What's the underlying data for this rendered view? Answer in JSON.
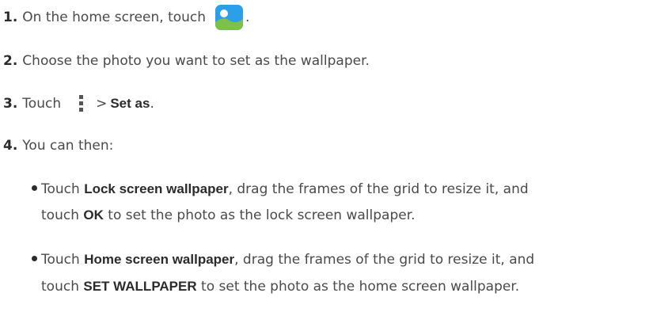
{
  "steps": [
    {
      "number": "1.",
      "text": "On the home screen, touch",
      "icon": "gallery-icon",
      "after": "."
    },
    {
      "number": "2.",
      "text": "Choose the photo you want to set as the wallpaper."
    },
    {
      "number": "3.",
      "text": "Touch",
      "icon": "more-vertical-icon",
      "gt": ">",
      "bold": "Set as",
      "after": "."
    },
    {
      "number": "4.",
      "text": "You can then:"
    }
  ],
  "bullets": [
    {
      "prefix": "Touch ",
      "bold1": "Lock screen wallpaper",
      "mid": ", drag the frames of the grid to resize it, and",
      "cont_prefix": "touch ",
      "bold2": "OK",
      "cont_suffix": " to set the photo as the lock screen wallpaper."
    },
    {
      "prefix": "Touch ",
      "bold1": "Home screen wallpaper",
      "mid": ", drag the frames of the grid to resize it, and",
      "cont_prefix": "touch ",
      "bold2": "SET WALLPAPER",
      "cont_suffix": " to set the photo as the home screen wallpaper."
    }
  ],
  "colors": {
    "text": "#4a4a4a",
    "heading": "#2b2b2b",
    "gallery_sky": "#2b9fe8",
    "gallery_hill": "#7cc24a",
    "gallery_sun": "#ffffff"
  }
}
